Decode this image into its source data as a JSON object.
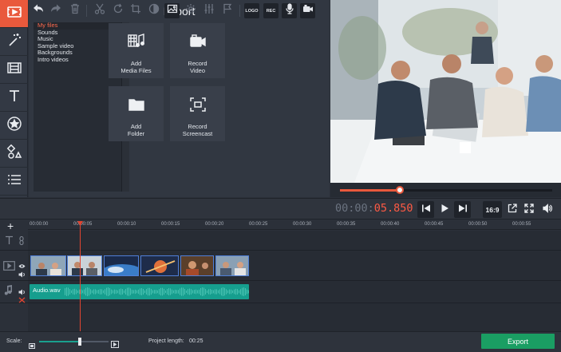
{
  "rail": {
    "items": [
      {
        "icon": "import-icon",
        "active": true
      },
      {
        "icon": "magic-wand-icon"
      },
      {
        "icon": "transitions-icon"
      },
      {
        "icon": "titles-icon"
      },
      {
        "icon": "stickers-icon"
      },
      {
        "icon": "shapes-icon"
      },
      {
        "icon": "more-tools-icon"
      }
    ]
  },
  "import": {
    "title": "Import",
    "files": [
      "My files",
      "Sounds",
      "Music",
      "Sample video",
      "Backgrounds",
      "Intro videos"
    ],
    "active_file": "My files",
    "tiles": [
      {
        "label": "Add\nMedia Files",
        "icon": "add-media-files-icon"
      },
      {
        "label": "Record\nVideo",
        "icon": "record-video-icon"
      },
      {
        "label": "Add\nFolder",
        "icon": "add-folder-icon"
      },
      {
        "label": "Record\nScreencast",
        "icon": "record-screencast-icon"
      }
    ],
    "collapse_glyph": "‹"
  },
  "player": {
    "timecode_dim": "00:00:",
    "timecode_active": "05.850",
    "aspect": "16:9",
    "progress": 0.28
  },
  "toolbar": {
    "logo_label": "LOGO",
    "rec_label": "REC"
  },
  "timeline": {
    "ticks": [
      "00:00:00",
      "00:00:05",
      "00:00:10",
      "00:00:15",
      "00:00:20",
      "00:00:25",
      "00:00:30",
      "00:00:35",
      "00:00:40",
      "00:00:45",
      "00:00:50",
      "00:00:55"
    ],
    "audio_clip": "Audio.wav",
    "add_glyph": "+"
  },
  "status": {
    "scale_label": "Scale:",
    "project_length_label": "Project length:",
    "project_length_value": "00:25",
    "export_label": "Export",
    "scale_value": 0.59
  },
  "colors": {
    "accent": "#e9593c",
    "audio": "#169e8e",
    "export": "#1a9e63",
    "clip_border": "#4f7fd8"
  }
}
